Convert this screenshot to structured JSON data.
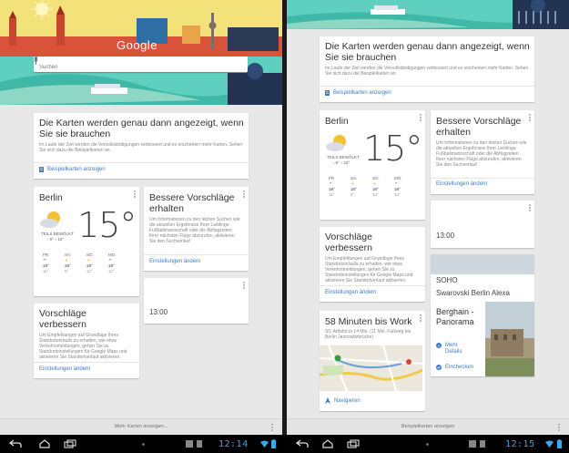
{
  "left": {
    "search": {
      "logo": "Google",
      "placeholder": "Suchen"
    },
    "intro": {
      "title": "Die Karten werden genau dann angezeigt, wenn Sie sie brauchen",
      "body": "Im Laufe der Zeit werden die Vervollständigungen verbessert und es erscheinen mehr Karten. Sehen Sie sich dazu die Beispielkarten an.",
      "link": "Beispielkarten anzeigen"
    },
    "weather": {
      "city": "Berlin",
      "temp": "15°",
      "condition": "TEILS BEWÖLKT",
      "range": "↓ 9° ↑ 18°",
      "forecast": [
        {
          "day": "FR.",
          "hi": "18°",
          "lo": "11°"
        },
        {
          "day": "SA.",
          "hi": "18°",
          "lo": "9°"
        },
        {
          "day": "SO.",
          "hi": "18°",
          "lo": "12°"
        },
        {
          "day": "MO.",
          "hi": "18°",
          "lo": "12°"
        }
      ]
    },
    "better": {
      "title": "Bessere Vorschläge erhalten",
      "body": "Um Informationen zu den letzten Suchen wie die aktuellen Ergebnisse Ihrer Lieblings-Fußballmannschaft oder die Abflugzeiten Ihrer nächsten Flüge abzurufen, aktivieren Sie den Suchverlauf",
      "link": "Einstellungen ändern"
    },
    "time": "13:00",
    "improve": {
      "title": "Vorschläge verbessern",
      "body": "Um Empfehlungen auf Grundlage Ihres Standortverlaufs zu erhalten, wie etwa Verkehrsmeldungen, gehen Sie zu Standorteinstellungen für Google Maps und aktivieren Sie Standortverlauf aktivieren.",
      "link": "Einstellungen ändern"
    },
    "more": "Mehr Karten anzeigen...",
    "clock": "12:14"
  },
  "right": {
    "intro": {
      "title": "Die Karten werden genau dann angezeigt, wenn Sie sie brauchen",
      "body": "Im Laufe der Zeit werden die Vervollständigungen verbessert und es erscheinen mehr Karten. Sehen Sie sich dazu die Beispielkarten an.",
      "link": "Beispielkarten anzeigen"
    },
    "weather": {
      "city": "Berlin",
      "temp": "15°",
      "condition": "TEILS BEWÖLKT",
      "range": "↓ 9° ↑ 18°",
      "forecast": [
        {
          "day": "FR.",
          "hi": "18°",
          "lo": "11°"
        },
        {
          "day": "SA.",
          "hi": "18°",
          "lo": "9°"
        },
        {
          "day": "SO.",
          "hi": "18°",
          "lo": "12°"
        },
        {
          "day": "MO.",
          "hi": "18°",
          "lo": "12°"
        }
      ]
    },
    "better": {
      "title": "Bessere Vorschläge erhalten",
      "body": "Um Informationen zu den letzten Suchen wie die aktuellen Ergebnisse Ihrer Lieblings-Fußballmannschaft oder die Abflugzeiten Ihrer nächsten Flüge abzurufen, aktivieren Sie den Suchverlauf",
      "link": "Einstellungen ändern"
    },
    "time": "13:00",
    "improve": {
      "title": "Vorschläge verbessern",
      "body": "Um Empfehlungen auf Grundlage Ihres Standortverlaufs zu erhalten, wie etwa Verkehrsmeldungen, gehen Sie zu Standorteinstellungen für Google Maps und aktivieren Sie Standortverlauf aktivieren.",
      "link": "Einstellungen ändern"
    },
    "commute": {
      "title": "58 Minuten bis Work",
      "body": "S5: Abfahrt in 14 Min. (11 Min. Fußweg bis Berlin Jannowitzbrücke)",
      "link": "Navigieren"
    },
    "stack": {
      "soho": "SOHO",
      "swarovski": "Swarovski Berlin Alexa",
      "place_title": "Berghain - Panorama",
      "details": "Mehr Details",
      "checkin": "Einchecken"
    },
    "more": "Beispielkarten anzeigen",
    "clock": "12:15"
  },
  "colors": {
    "accent": "#3a7dc9",
    "sky": "#f3e27a",
    "water": "#5fcfc0",
    "clock": "#3ba9e6"
  }
}
